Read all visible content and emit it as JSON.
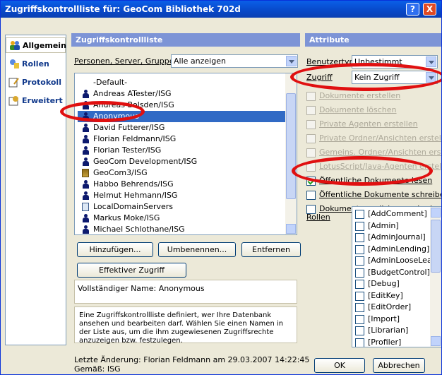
{
  "window": {
    "title": "Zugriffskontrollliste für: GeoCom Bibliothek 702d",
    "help": "?",
    "close": "X"
  },
  "nav": {
    "items": [
      {
        "label": "Allgemein",
        "selected": true,
        "icon": "people-icon"
      },
      {
        "label": "Rollen",
        "icon": "roles-icon"
      },
      {
        "label": "Protokoll",
        "icon": "log-icon"
      },
      {
        "label": "Erweitert",
        "icon": "advanced-icon"
      }
    ]
  },
  "left": {
    "header": "Zugriffskontrollliste",
    "filter_label": "Personen, Server, Gruppen",
    "filter_value": "Alle anzeigen",
    "entries": [
      {
        "name": "-Default-",
        "icon": "none"
      },
      {
        "name": "Andreas ATester/ISG",
        "icon": "person"
      },
      {
        "name": "Andreas Bolsden/ISG",
        "icon": "person"
      },
      {
        "name": "Anonymous",
        "icon": "person",
        "selected": true
      },
      {
        "name": "David Futterer/ISG",
        "icon": "person"
      },
      {
        "name": "Florian Feldmann/ISG",
        "icon": "person"
      },
      {
        "name": "Florian Tester/ISG",
        "icon": "person"
      },
      {
        "name": "GeoCom Development/ISG",
        "icon": "person"
      },
      {
        "name": "GeoCom3/ISG",
        "icon": "group"
      },
      {
        "name": "Habbo Behrends/ISG",
        "icon": "person"
      },
      {
        "name": "Helmut Hehmann/ISG",
        "icon": "person"
      },
      {
        "name": "LocalDomainServers",
        "icon": "server"
      },
      {
        "name": "Markus Moke/ISG",
        "icon": "person"
      },
      {
        "name": "Michael Schlothane/ISG",
        "icon": "person"
      }
    ],
    "btn_add": "Hinzufügen...",
    "btn_rename": "Umbenennen...",
    "btn_remove": "Entfernen",
    "btn_effective": "Effektiver Zugriff",
    "fullname": "Vollständiger Name: Anonymous",
    "info": "Eine Zugriffskontrollliste definiert, wer Ihre Datenbank ansehen und bearbeiten darf. Wählen Sie einen Namen in der Liste aus, um die ihm zugewiesenen Zugriffsrechte anzuzeigen bzw. festzulegen."
  },
  "right": {
    "header": "Attribute",
    "usertype_label": "Benutzertyp",
    "usertype_value": "Unbestimmt",
    "access_label": "Zugriff",
    "access_value": "Kein Zugriff",
    "checks": [
      {
        "label": "Dokumente erstellen",
        "checked": false,
        "enabled": false
      },
      {
        "label": "Dokumente löschen",
        "checked": false,
        "enabled": false
      },
      {
        "label": "Private Agenten erstellen",
        "checked": false,
        "enabled": false
      },
      {
        "label": "Private Ordner/Ansichten erstellen",
        "checked": false,
        "enabled": false
      },
      {
        "label": "Gemeins. Ordner/Ansichten erstellen",
        "checked": false,
        "enabled": false
      },
      {
        "label": "LotusScript/Java-Agenten erstellen",
        "checked": false,
        "enabled": false
      },
      {
        "label": "Öffentliche Dokumente lesen",
        "checked": true,
        "enabled": true
      },
      {
        "label": "Öffentliche Dokumente schreiben",
        "checked": false,
        "enabled": true
      },
      {
        "label": "Dokumente replizieren oder kopieren",
        "checked": false,
        "enabled": true
      }
    ],
    "roles_label": "Rollen",
    "roles": [
      "[AddComment]",
      "[Admin]",
      "[AdminJournal]",
      "[AdminLending]",
      "[AdminLooseLea",
      "[BudgetControl]",
      "[Debug]",
      "[EditKey]",
      "[EditOrder]",
      "[Import]",
      "[Librarian]",
      "[Profiler]"
    ]
  },
  "footer": {
    "last_change": "Letzte Änderung: Florian Feldmann am 29.03.2007 14:22:45",
    "according": "Gemäß: ISG",
    "ok": "OK",
    "cancel": "Abbrechen"
  },
  "colors": {
    "title_bar": "#0a5fe8",
    "selection": "#316ac5",
    "group_header": "#7d94d6",
    "annotation_ring": "#e01010"
  }
}
